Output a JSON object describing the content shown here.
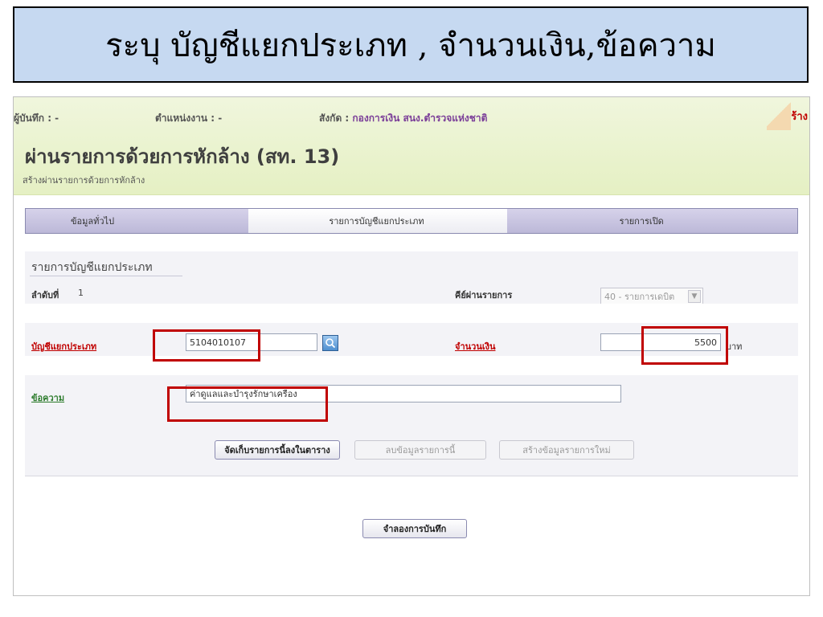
{
  "slide": {
    "title": "ระบุ บัญชีแยกประเภท , จำนวนเงิน,ข้อความ"
  },
  "header": {
    "user_label": "ผู้บันทึก : -",
    "position_label": "ตำแหน่งงาน : -",
    "department_label": "สังกัด : ",
    "department_value": "กองการเงิน สนง.ตำรวจแห่งชาติ",
    "create_label": "สร้าง",
    "title": "ผ่านรายการด้วยการหักล้าง (สท. 13)",
    "subtitle": "สร้างผ่านรายการด้วยการหักล้าง"
  },
  "tabs": [
    {
      "label": "ข้อมูลทั่วไป",
      "active": false
    },
    {
      "label": "รายการบัญชีแยกประเภท",
      "active": true
    },
    {
      "label": "รายการเปิด",
      "active": false
    }
  ],
  "form": {
    "section_title": "รายการบัญชีแยกประเภท",
    "seq_label": "ลำดับที่",
    "seq_value": "1",
    "posting_key_label": "คีย์ผ่านรายการ",
    "posting_key_value": "40 - รายการเดบิต",
    "gl_label": "บัญชีแยกประเภท",
    "gl_value": "5104010107",
    "amount_label": "จำนวนเงิน",
    "amount_value": "5500",
    "amount_unit": "บาท",
    "text_label": "ข้อความ",
    "text_value": "ค่าดูแลและบำรุงรักษาเครื่อง"
  },
  "buttons": {
    "store": "จัดเก็บรายการนี้ลงในตาราง",
    "delete": "ลบข้อมูลรายการนี้",
    "new": "สร้างข้อมูลรายการใหม่",
    "simulate": "จำลองการบันทึก"
  },
  "colors": {
    "banner_bg": "#c6d9f1",
    "header_bg": "#e5f0c3",
    "highlight": "#c00000",
    "label_red": "#c00000"
  }
}
